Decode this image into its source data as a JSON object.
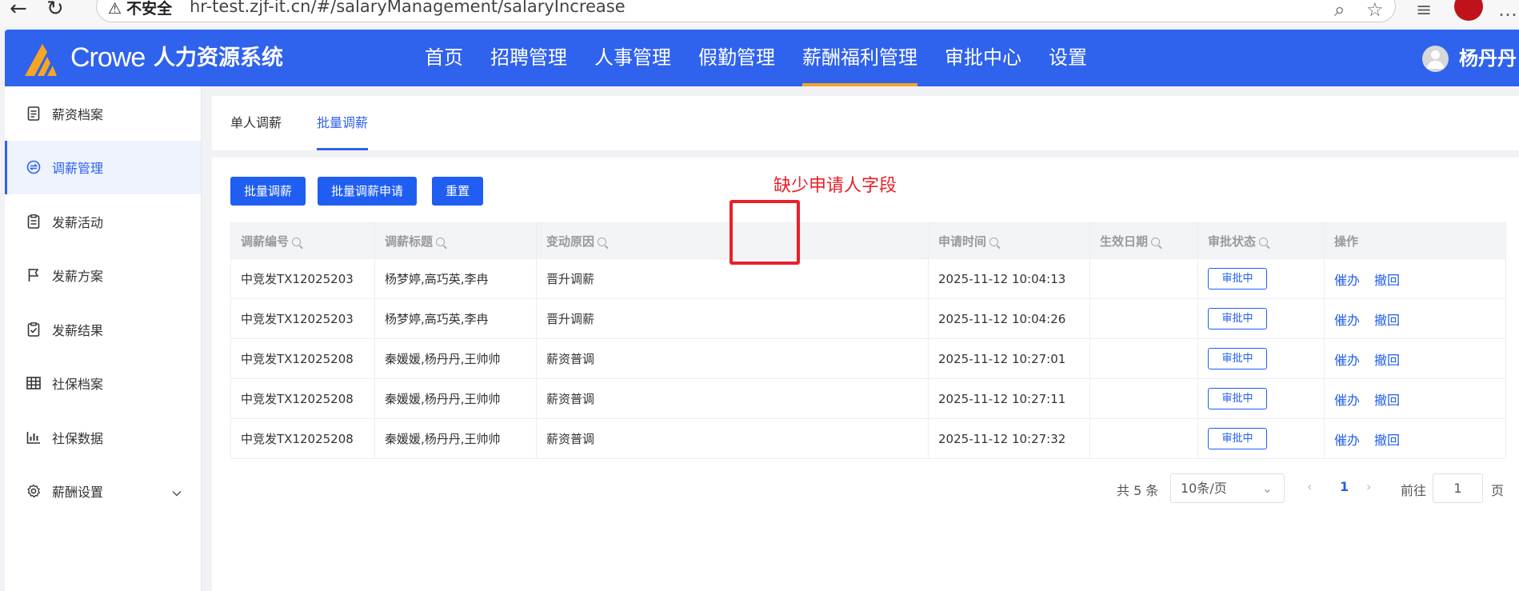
{
  "browser": {
    "security_label": "不安全",
    "url": "hr-test.zjf-it.cn/#/salaryManagement/salaryIncrease"
  },
  "header": {
    "brand": "Crowe",
    "system_name": "人力资源系统",
    "nav": [
      "首页",
      "招聘管理",
      "人事管理",
      "假勤管理",
      "薪酬福利管理",
      "审批中心",
      "设置"
    ],
    "active_nav": "薪酬福利管理",
    "user_name": "杨丹丹",
    "colors": {
      "header_bg": "#2f62ed",
      "nav_underline": "#f5a623"
    }
  },
  "sidebar": {
    "items": [
      {
        "label": "薪资档案",
        "icon": "document-icon"
      },
      {
        "label": "调薪管理",
        "icon": "exchange-icon"
      },
      {
        "label": "发薪活动",
        "icon": "clipboard-icon"
      },
      {
        "label": "发薪方案",
        "icon": "flag-icon"
      },
      {
        "label": "发薪结果",
        "icon": "clipboard-check-icon"
      },
      {
        "label": "社保档案",
        "icon": "grid-icon"
      },
      {
        "label": "社保数据",
        "icon": "bar-chart-icon"
      },
      {
        "label": "薪酬设置",
        "icon": "gear-icon"
      }
    ],
    "active": "调薪管理"
  },
  "tabs": {
    "single": "单人调薪",
    "batch": "批量调薪",
    "active": "批量调薪"
  },
  "toolbar": {
    "batch_adjust": "批量调薪",
    "batch_apply": "批量调薪申请",
    "reset": "重置"
  },
  "annotation": {
    "text": "缺少申请人字段",
    "color": "#e8202a"
  },
  "table": {
    "columns": [
      "调薪编号",
      "调薪标题",
      "变动原因",
      "",
      "申请时间",
      "生效日期",
      "审批状态",
      "操作"
    ],
    "rows": [
      {
        "id": "中竞发TX12025203",
        "title": "杨梦婷,高巧英,李冉",
        "reason": "晋升调薪",
        "blank": "",
        "apply_time": "2025-11-12 10:04:13",
        "effective": "",
        "status": "审批中"
      },
      {
        "id": "中竞发TX12025203",
        "title": "杨梦婷,高巧英,李冉",
        "reason": "晋升调薪",
        "blank": "",
        "apply_time": "2025-11-12 10:04:26",
        "effective": "",
        "status": "审批中"
      },
      {
        "id": "中竞发TX12025208",
        "title": "秦媛媛,杨丹丹,王帅帅",
        "reason": "薪资普调",
        "blank": "",
        "apply_time": "2025-11-12 10:27:01",
        "effective": "",
        "status": "审批中"
      },
      {
        "id": "中竞发TX12025208",
        "title": "秦媛媛,杨丹丹,王帅帅",
        "reason": "薪资普调",
        "blank": "",
        "apply_time": "2025-11-12 10:27:11",
        "effective": "",
        "status": "审批中"
      },
      {
        "id": "中竞发TX12025208",
        "title": "秦媛媛,杨丹丹,王帅帅",
        "reason": "薪资普调",
        "blank": "",
        "apply_time": "2025-11-12 10:27:32",
        "effective": "",
        "status": "审批中"
      }
    ],
    "actions": {
      "urge": "催办",
      "withdraw": "撤回"
    }
  },
  "pagination": {
    "total_text": "共 5 条",
    "page_size": "10条/页",
    "current_page": "1",
    "goto_label": "前往",
    "goto_value": "1",
    "page_unit": "页"
  }
}
